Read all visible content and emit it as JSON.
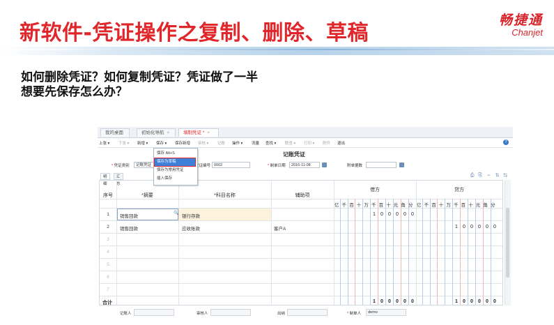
{
  "slide": {
    "title": "新软件-凭证操作之复制、删除、草稿",
    "brand_cn": "畅捷通",
    "brand_en": "Chanjet",
    "question_line1": "如何删除凭证？如何复制凭证？凭证做了一半",
    "question_line2": "想要先保存怎么办？"
  },
  "tabs": [
    {
      "label": "我的桌面"
    },
    {
      "label": "初始化导航",
      "close": "×"
    },
    {
      "label": "填制凭证 *",
      "close": "×"
    }
  ],
  "toolbar": {
    "items": [
      "上张 ▾",
      "下张 ▾",
      "新增 ▾",
      "保存 ▾",
      "保存新增",
      "审核 ▾",
      "记账",
      "操作 ▾",
      "流量",
      "查找 ▾",
      "联查 ▾",
      "打印 ▾",
      "附件",
      "退出"
    ],
    "help": "?"
  },
  "save_menu": {
    "items": [
      "保存  Alt+S",
      "保存为草稿",
      "保存为常用凭证",
      "插入保存"
    ],
    "selected_index": 1
  },
  "voucher": {
    "title": "记账凭证",
    "type_label": "凭证类别",
    "type_value": "记账凭证",
    "number_label": "凭证编号",
    "number_value": "0002",
    "date_label": "制单日期",
    "date_value": "2016-11-08",
    "attachments_label": "附单据数",
    "attachments_value": "",
    "subtabs": [
      "明细",
      "汇总"
    ],
    "right_icons": "⎙ ⎘ ⇔ ⇅ ⇆"
  },
  "grid": {
    "headers": {
      "seq": "序号",
      "summary": "*摘要",
      "account": "*科目名称",
      "aux": "辅助项",
      "debit": "借方",
      "credit": "贷方",
      "digits": "亿千百十万千百十元角分"
    },
    "rows": [
      {
        "seq": "1",
        "summary": "销售回款",
        "account": "银行存款",
        "aux": "",
        "debit": "100000",
        "credit": ""
      },
      {
        "seq": "2",
        "summary": "销售回款",
        "account": "应收账款",
        "aux": "客户A",
        "debit": "",
        "credit": "100000"
      },
      {
        "seq": "3"
      },
      {
        "seq": "4"
      },
      {
        "seq": "5"
      },
      {
        "seq": "6"
      },
      {
        "seq": "7"
      }
    ],
    "total_label": "合计",
    "total_debit": "100000",
    "total_credit": "100000"
  },
  "footer": {
    "bookkeeper_label": "记账人",
    "auditor_label": "审核人",
    "cashier_label": "出纳",
    "maker_label": "制单人",
    "maker_value": "demo"
  }
}
